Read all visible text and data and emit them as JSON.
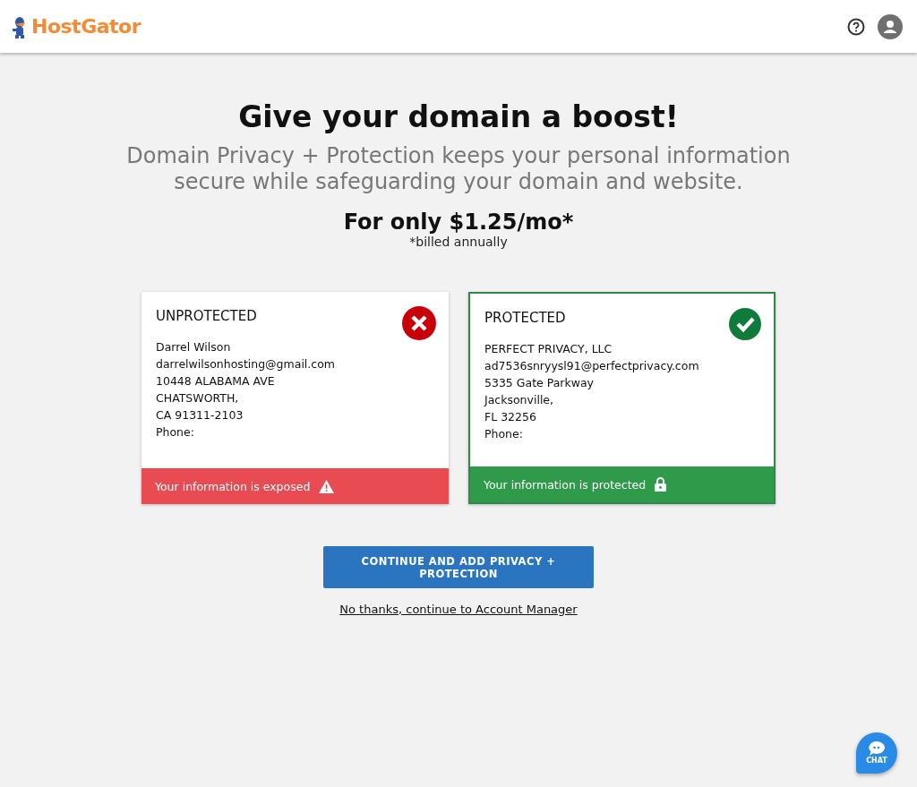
{
  "header": {
    "logo": "HostGator"
  },
  "title": "Give your domain a boost!",
  "subtitle": "Domain Privacy + Protection keeps your personal information secure while safeguarding your domain and website.",
  "price": "For only $1.25/mo*",
  "billing_note": "*billed annually",
  "cards": [
    {
      "kind": "unprotected",
      "title": "UNPROTECTED",
      "lines": [
        "Darrel Wilson",
        "darrelwilsonhosting@gmail.com",
        "10448 ALABAMA AVE",
        "CHATSWORTH,",
        "CA 91311-2103",
        "Phone:"
      ],
      "footer": "Your information is exposed"
    },
    {
      "kind": "protected",
      "title": "PROTECTED",
      "lines": [
        "PERFECT PRIVACY, LLC",
        "ad7536snryysl91@perfectprivacy.com",
        "5335 Gate Parkway",
        "Jacksonville,",
        "FL 32256",
        "Phone:"
      ],
      "footer": "Your information is protected"
    }
  ],
  "primary_button": "CONTINUE AND ADD PRIVACY + PROTECTION",
  "secondary_link": "No thanks, continue to Account Manager",
  "chat": {
    "label": "CHAT"
  }
}
